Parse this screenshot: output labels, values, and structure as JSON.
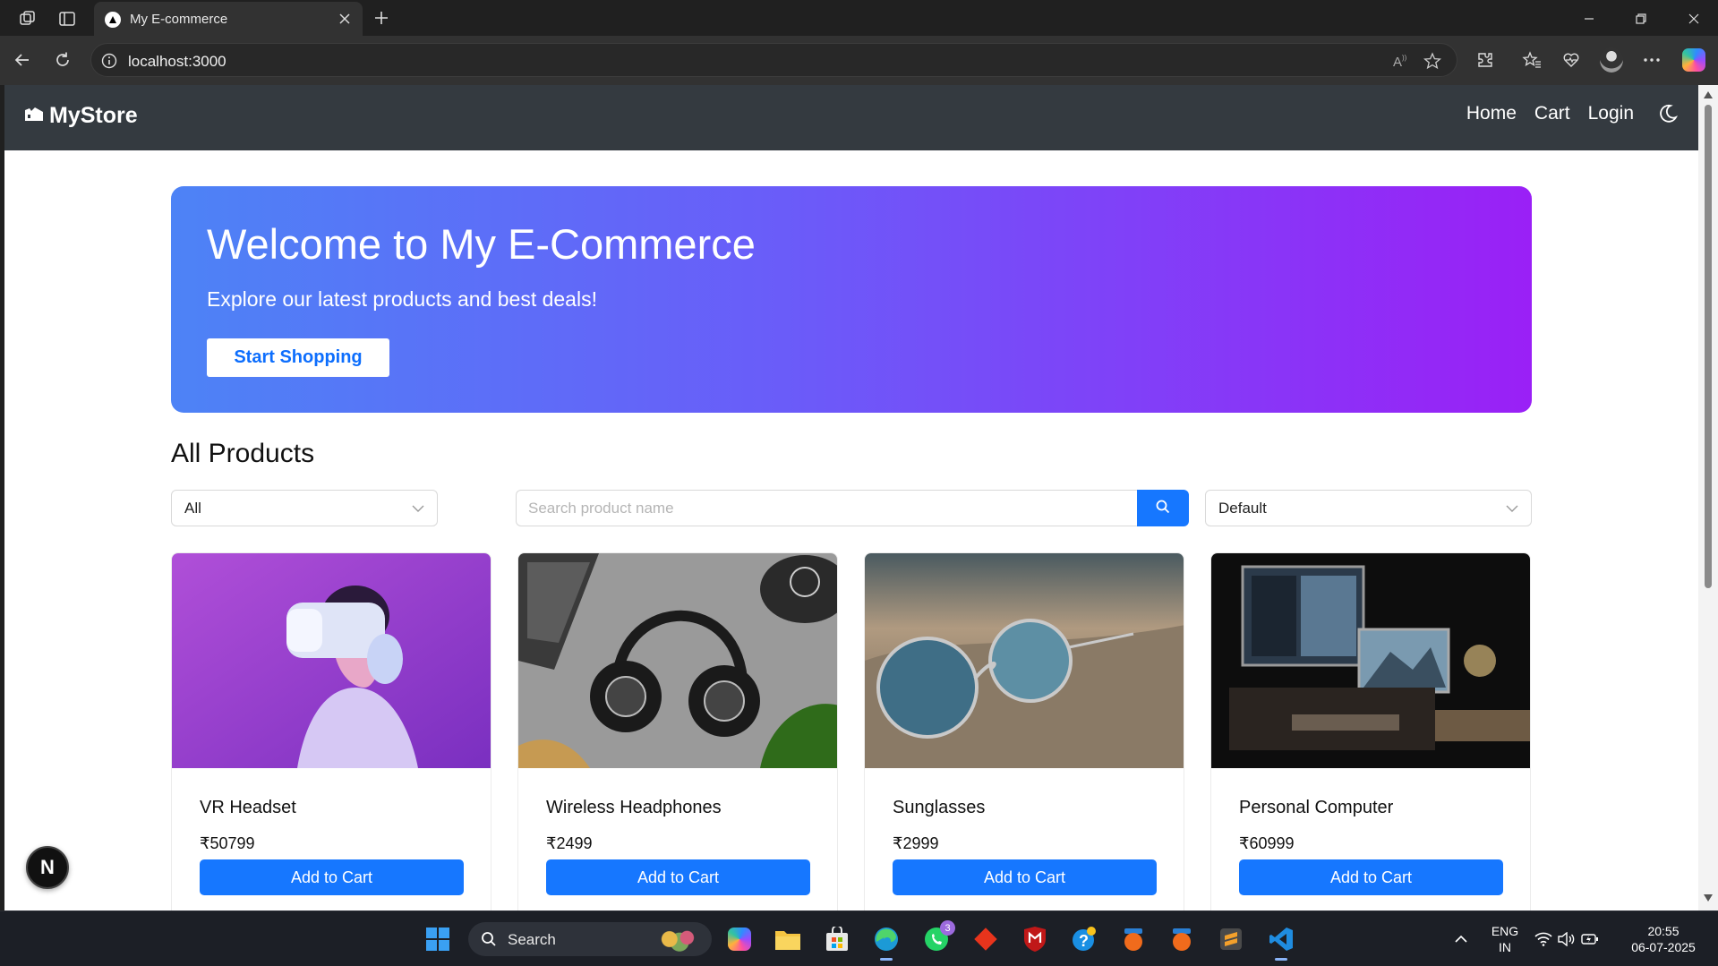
{
  "browser": {
    "tab_title": "My E-commerce",
    "url": "localhost:3000"
  },
  "navbar": {
    "brand": "MyStore",
    "links": [
      "Home",
      "Cart",
      "Login"
    ]
  },
  "hero": {
    "title": "Welcome to My E-Commerce",
    "subtitle": "Explore our latest products and best deals!",
    "button": "Start Shopping",
    "gradient_start": "#4d83f6",
    "gradient_end": "#9a20f6"
  },
  "products_section": {
    "title": "All Products",
    "category_select": "All",
    "search_placeholder": "Search product name",
    "sort_select": "Default"
  },
  "products": [
    {
      "name": "VR Headset",
      "price": "₹50799",
      "button": "Add to Cart",
      "image_icon": "vr-headset-photo"
    },
    {
      "name": "Wireless Headphones",
      "price": "₹2499",
      "button": "Add to Cart",
      "image_icon": "headphones-photo"
    },
    {
      "name": "Sunglasses",
      "price": "₹2999",
      "button": "Add to Cart",
      "image_icon": "sunglasses-photo"
    },
    {
      "name": "Personal Computer",
      "price": "₹60999",
      "button": "Add to Cart",
      "image_icon": "computer-photo"
    }
  ],
  "dev_badge": "N",
  "colors": {
    "navbar_bg": "#343a40",
    "primary": "#1677ff"
  },
  "taskbar": {
    "search_label": "Search",
    "whatsapp_badge": "3",
    "language": "ENG",
    "region": "IN",
    "time": "20:55",
    "date": "06-07-2025"
  }
}
